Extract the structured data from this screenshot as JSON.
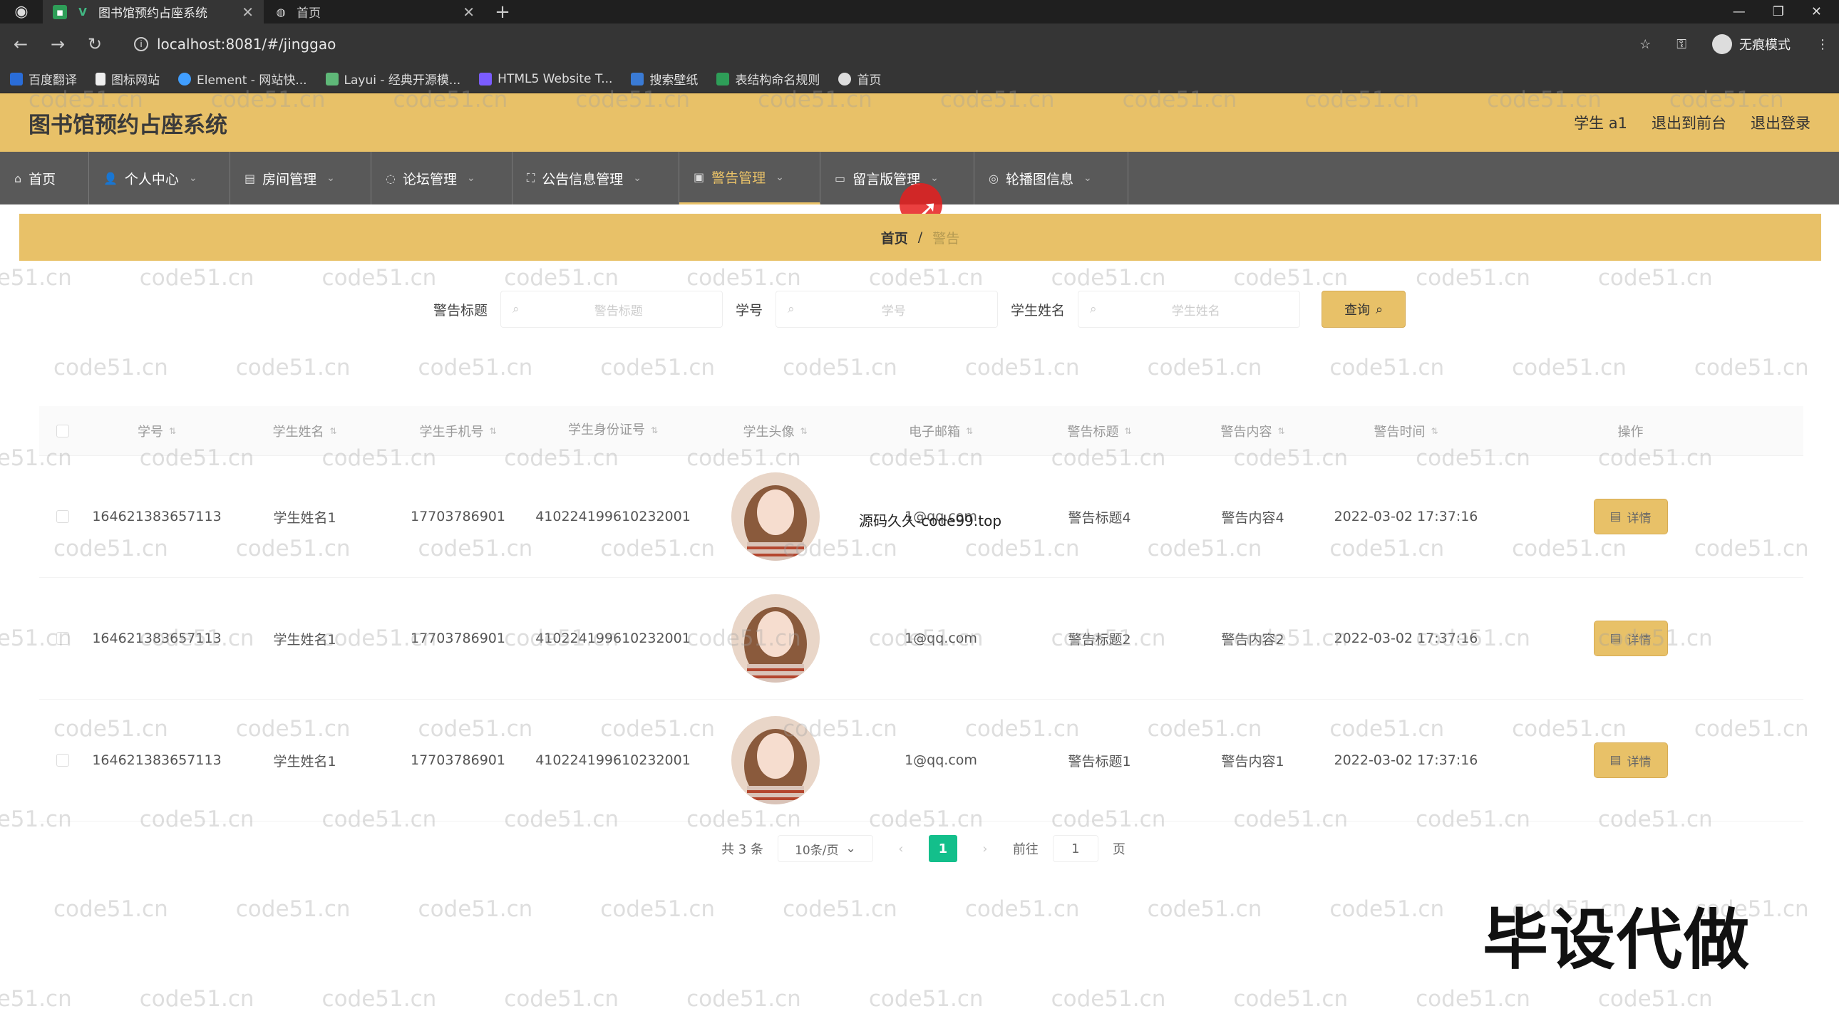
{
  "browser": {
    "tabs": [
      {
        "label": "图书馆预约占座系统",
        "active": true
      },
      {
        "label": "首页",
        "active": false
      }
    ],
    "url": "localhost:8081/#/jinggao",
    "profile_label": "无痕模式",
    "bookmarks": [
      "百度翻译",
      "图标网站",
      "Element - 网站快...",
      "Layui - 经典开源模...",
      "HTML5 Website T...",
      "搜索壁纸",
      "表结构命名规则",
      "首页"
    ]
  },
  "header": {
    "title": "图书馆预约占座系统",
    "user": "学生 a1",
    "to_front": "退出到前台",
    "logout": "退出登录"
  },
  "nav": [
    {
      "label": "首页",
      "icon": "home-icon"
    },
    {
      "label": "个人中心",
      "icon": "user-icon",
      "caret": true
    },
    {
      "label": "房间管理",
      "icon": "room-icon",
      "caret": true
    },
    {
      "label": "论坛管理",
      "icon": "forum-icon",
      "caret": true
    },
    {
      "label": "公告信息管理",
      "icon": "notice-icon",
      "caret": true
    },
    {
      "label": "警告管理",
      "icon": "warning-icon",
      "caret": true,
      "active": true
    },
    {
      "label": "留言版管理",
      "icon": "message-icon",
      "caret": true
    },
    {
      "label": "轮播图信息",
      "icon": "carousel-icon",
      "caret": true
    }
  ],
  "breadcrumb": {
    "home": "首页",
    "sep": "/",
    "current": "警告"
  },
  "search": {
    "fields": [
      {
        "label": "警告标题",
        "placeholder": "警告标题"
      },
      {
        "label": "学号",
        "placeholder": "学号"
      },
      {
        "label": "学生姓名",
        "placeholder": "学生姓名"
      }
    ],
    "button": "查询"
  },
  "table": {
    "headers": [
      "学号",
      "学生姓名",
      "学生手机号",
      "学生身份证号",
      "学生头像",
      "电子邮箱",
      "警告标题",
      "警告内容",
      "警告时间",
      "操作"
    ],
    "rows": [
      {
        "sid": "164621383657113",
        "name": "学生姓名1",
        "phone": "17703786901",
        "idno": "410224199610232001",
        "email": "1@qq.com",
        "title": "警告标题4",
        "content": "警告内容4",
        "time": "2022-03-02 17:37:16",
        "action": "详情"
      },
      {
        "sid": "164621383657113",
        "name": "学生姓名1",
        "phone": "17703786901",
        "idno": "410224199610232001",
        "email": "1@qq.com",
        "title": "警告标题2",
        "content": "警告内容2",
        "time": "2022-03-02 17:37:16",
        "action": "详情"
      },
      {
        "sid": "164621383657113",
        "name": "学生姓名1",
        "phone": "17703786901",
        "idno": "410224199610232001",
        "email": "1@qq.com",
        "title": "警告标题1",
        "content": "警告内容1",
        "time": "2022-03-02 17:37:16",
        "action": "详情"
      }
    ],
    "row1_overlay": "源码久久-code99.top"
  },
  "pagination": {
    "total": "共 3 条",
    "page_size": "10条/页",
    "current": "1",
    "goto_label": "前往",
    "goto_value": "1",
    "page_unit": "页"
  },
  "watermark": "code51.cn",
  "promo": "毕设代做",
  "colors": {
    "accent": "#e8c168",
    "nav_bg": "#595959",
    "page_active": "#13bf8b"
  }
}
